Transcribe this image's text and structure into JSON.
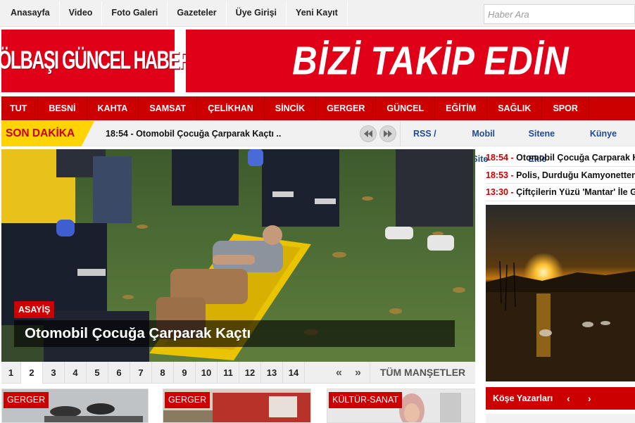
{
  "topnav": {
    "items": [
      "Anasayfa",
      "Video",
      "Foto Galeri",
      "Gazeteler",
      "Üye Girişi",
      "Yeni Kayıt"
    ],
    "search_placeholder": "Haber Ara"
  },
  "header": {
    "logo_text": "GÖLBAŞI GÜNCEL HABER",
    "banner_text": "BİZİ TAKİP EDİN"
  },
  "catnav": [
    "TUT",
    "BESNİ",
    "KAHTA",
    "SAMSAT",
    "ÇELİKHAN",
    "SİNCİK",
    "GERGER",
    "GÜNCEL",
    "EĞİTİM",
    "SAĞLIK",
    "SPOR"
  ],
  "breaking": {
    "label": "SON DAKİKA",
    "text": "18:54 - Otomobil Çocuğa Çarparak Kaçtı ..",
    "links": [
      "RSS / XML",
      "Mobil Site",
      "Sitene Ekle",
      "Künye"
    ]
  },
  "slider": {
    "category": "ASAYİŞ",
    "headline": "Otomobil Çocuğa Çarparak Kaçtı",
    "pages": [
      "1",
      "2",
      "3",
      "4",
      "5",
      "6",
      "7",
      "8",
      "9",
      "10",
      "11",
      "12",
      "13",
      "14"
    ],
    "prev": "«",
    "next": "»",
    "all_label": "TÜM MANŞETLER"
  },
  "right_news": [
    {
      "time": "18:54",
      "title": "Otomobil Çocuğa Çarparak K"
    },
    {
      "time": "18:53",
      "title": "Polis, Durduğu Kamyonetten"
    },
    {
      "time": "13:30",
      "title": "Çiftçilerin Yüzü 'Mantar' İle Gü"
    }
  ],
  "kose": {
    "label": "Köşe Yazarları",
    "prev": "‹",
    "next": "›"
  },
  "cards": [
    {
      "tag": "GERGER"
    },
    {
      "tag": "GERGER"
    },
    {
      "tag": "KÜLTÜR-SANAT"
    }
  ],
  "colors": {
    "brand_red": "#e00018",
    "nav_red": "#cc0000",
    "breaking_yellow": "#ffd400",
    "link_blue": "#1f4a91"
  }
}
